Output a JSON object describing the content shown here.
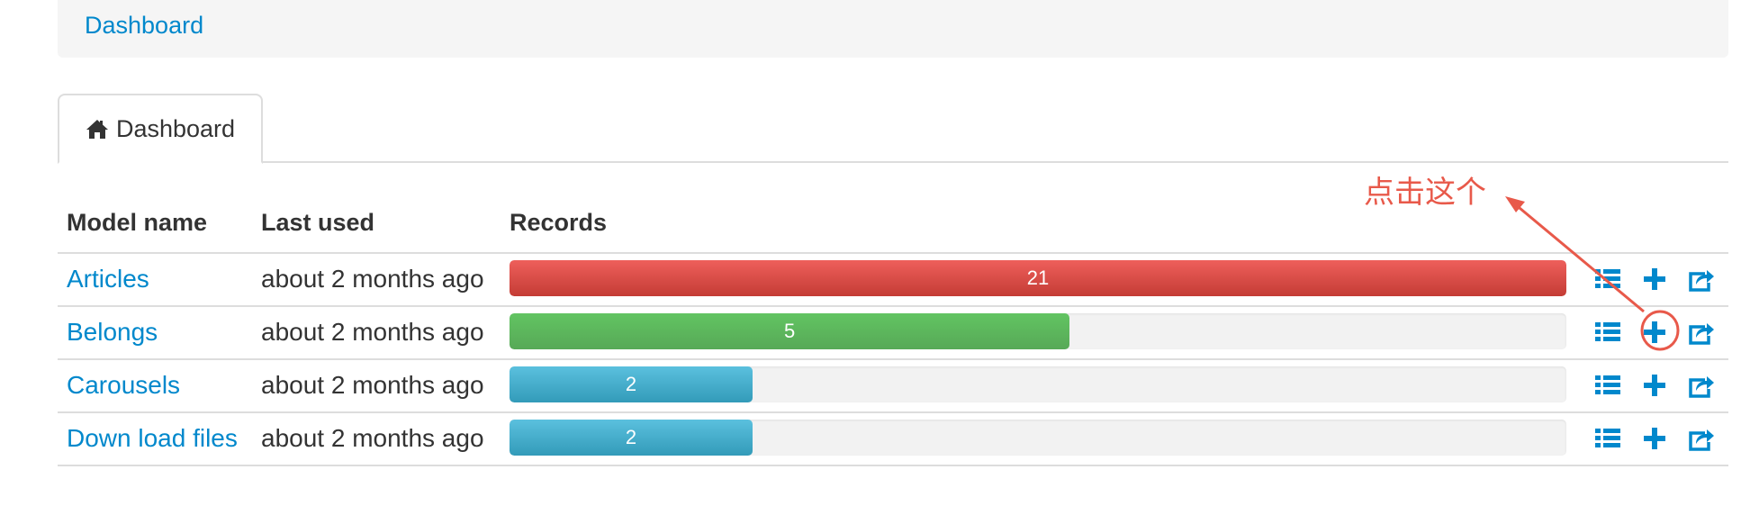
{
  "breadcrumb": {
    "label": "Dashboard"
  },
  "tabs": [
    {
      "label": "Dashboard",
      "icon": "home-icon"
    }
  ],
  "table": {
    "headers": {
      "model": "Model name",
      "last_used": "Last used",
      "records": "Records"
    },
    "rows": [
      {
        "model": "Articles",
        "last_used": "about 2 months ago",
        "records": "21",
        "fill": 1.0,
        "color": "#d9534f"
      },
      {
        "model": "Belongs",
        "last_used": "about 2 months ago",
        "records": "5",
        "fill": 0.53,
        "color": "#5cb85c"
      },
      {
        "model": "Carousels",
        "last_used": "about 2 months ago",
        "records": "2",
        "fill": 0.23,
        "color": "#46b8da"
      },
      {
        "model": "Down load files",
        "last_used": "about 2 months ago",
        "records": "2",
        "fill": 0.23,
        "color": "#46b8da"
      }
    ],
    "action_icons": [
      "list-icon",
      "plus-icon",
      "export-icon"
    ]
  },
  "annotation": {
    "text": "点击这个",
    "color": "#e8594a"
  },
  "colors": {
    "link": "#0088cc",
    "icon": "#0088cc"
  }
}
